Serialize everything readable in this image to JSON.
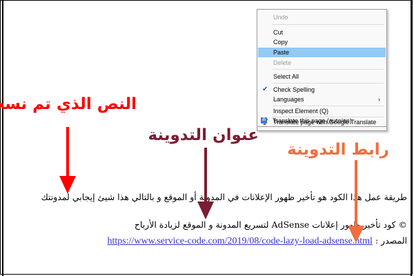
{
  "context_menu": {
    "items": [
      {
        "label": "Undo",
        "disabled": true
      },
      {
        "label": "Cut"
      },
      {
        "label": "Copy"
      },
      {
        "label": "Paste",
        "highlighted": true
      },
      {
        "label": "Delete",
        "disabled": true
      },
      {
        "label": "Select All"
      },
      {
        "label": "Check Spelling",
        "checked": true
      },
      {
        "label": "Languages",
        "submenu": true
      },
      {
        "label": "Inspect Element (Q)"
      },
      {
        "label": "Translate page with Google Translate",
        "icon": "google-translate-icon"
      },
      {
        "label": "Translate this page (auto/en)",
        "icon": "translate-icon"
      }
    ],
    "submenu_arrow": "›",
    "checkmark": "✔",
    "gt_icon_glyph": "T",
    "tr_icon_glyph": "あ"
  },
  "annotations": {
    "copied_text": "النص الذي تم نسخه",
    "post_title": "عنوان التدوينة",
    "post_link": "رابط التدوينة"
  },
  "colors": {
    "red": "#ff0000",
    "maroon": "#7b1d33",
    "orange": "#f26d3d",
    "highlight": "#91c9f7"
  },
  "content": {
    "line1": "طريقة عمل هذا الكود هو تأخير ظهور الإعلانات في المدونة أو الموقع و بالتالي هذا شيئ إيجابي لمدونتك",
    "line2": "© كود تأخير ظهور إعلانات AdSense لتسريع المدونة و الموقع لزيادة الأرباح",
    "source_label": "المصدر :",
    "source_url": "https://www.service-code.com/2019/08/code-lazy-load-adsense.html"
  }
}
